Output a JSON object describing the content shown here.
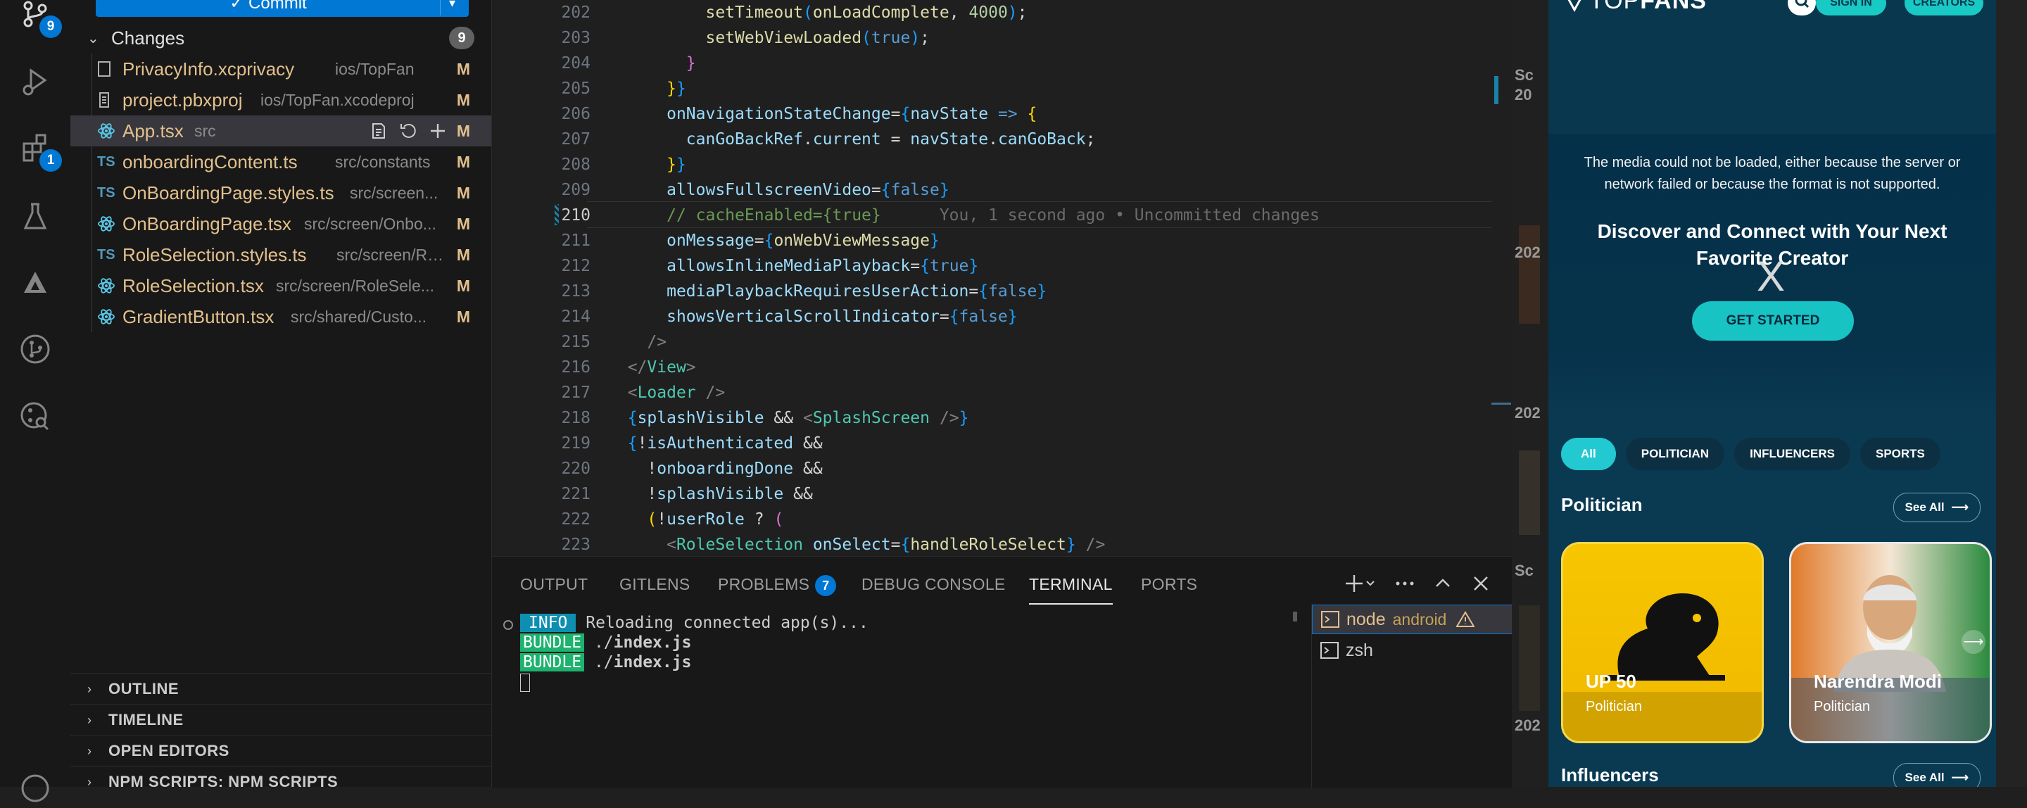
{
  "activity_bar": {
    "scm_badge": "9",
    "extensions_badge": "1"
  },
  "scm": {
    "commit_label": "✓ Commit",
    "changes_title": "Changes",
    "changes_count": "9",
    "files": [
      {
        "icon": "swift",
        "name": "PrivacyInfo.xcprivacy",
        "path": "ios/TopFan",
        "status": "M"
      },
      {
        "icon": "proj",
        "name": "project.pbxproj",
        "path": "ios/TopFan.xcodeproj",
        "status": "M"
      },
      {
        "icon": "tsx",
        "name": "App.tsx",
        "path": "src",
        "status": "M"
      },
      {
        "icon": "ts",
        "name": "onboardingContent.ts",
        "path": "src/constants",
        "status": "M"
      },
      {
        "icon": "ts",
        "name": "OnBoardingPage.styles.ts",
        "path": "src/screen...",
        "status": "M"
      },
      {
        "icon": "tsx",
        "name": "OnBoardingPage.tsx",
        "path": "src/screen/Onbo...",
        "status": "M"
      },
      {
        "icon": "ts",
        "name": "RoleSelection.styles.ts",
        "path": "src/screen/Ro...",
        "status": "M"
      },
      {
        "icon": "tsx",
        "name": "RoleSelection.tsx",
        "path": "src/screen/RoleSele...",
        "status": "M"
      },
      {
        "icon": "tsx",
        "name": "GradientButton.tsx",
        "path": "src/shared/Custo...",
        "status": "M"
      }
    ],
    "ts_icon_label": "TS",
    "sections": [
      "OUTLINE",
      "TIMELINE",
      "OPEN EDITORS",
      "NPM SCRIPTS: NPM SCRIPTS"
    ]
  },
  "editor": {
    "line_numbers": [
      "202",
      "203",
      "204",
      "205",
      "206",
      "207",
      "208",
      "209",
      "210",
      "211",
      "212",
      "213",
      "214",
      "215",
      "216",
      "217",
      "218",
      "219",
      "220",
      "221",
      "222",
      "223"
    ],
    "current_line": "210",
    "blame": "You, 1 second ago • Uncommitted changes"
  },
  "panel": {
    "tabs": [
      "OUTPUT",
      "GITLENS",
      "PROBLEMS",
      "DEBUG CONSOLE",
      "TERMINAL",
      "PORTS"
    ],
    "problems_count": "7",
    "active_tab": "TERMINAL",
    "terminal": {
      "info_tag": "INFO",
      "info_text": "Reloading connected app(s)...",
      "bundle_tag": "BUNDLE",
      "bundle_path_prefix": "./",
      "bundle_file": "index.js"
    },
    "terminals": [
      {
        "name": "node",
        "sub": "android",
        "warning": true
      },
      {
        "name": "zsh",
        "sub": "",
        "warning": false
      }
    ]
  },
  "phone_app": {
    "brand_light": "TOP",
    "brand_bold": "FANS",
    "sign_in": "SIGN IN",
    "creators": "CREATORS",
    "error_text": "The media could not be loaded, either because the server or network failed or because the format is not supported.",
    "headline": "Discover and Connect with Your Next Favorite Creator",
    "close_mark": "X",
    "cta": "GET STARTED",
    "chips": [
      "All",
      "POLITICIAN",
      "INFLUENCERS",
      "SPORTS"
    ],
    "active_chip": "All",
    "section_politician": "Politician",
    "section_influencers": "Influencers",
    "see_all": "See All",
    "cards": [
      {
        "name": "UP 50",
        "role": "Politician"
      },
      {
        "name": "Narendra Modi",
        "role": "Politician"
      }
    ]
  },
  "behind_strip": [
    "Sc",
    "20",
    "202",
    "202",
    "Sc",
    "202"
  ],
  "colors": {
    "accent": "#0078d4",
    "modified": "#e2c08d",
    "app_bg": "#0a3a52",
    "teal": "#19c9c4",
    "card_yellow": "#f5c400"
  }
}
